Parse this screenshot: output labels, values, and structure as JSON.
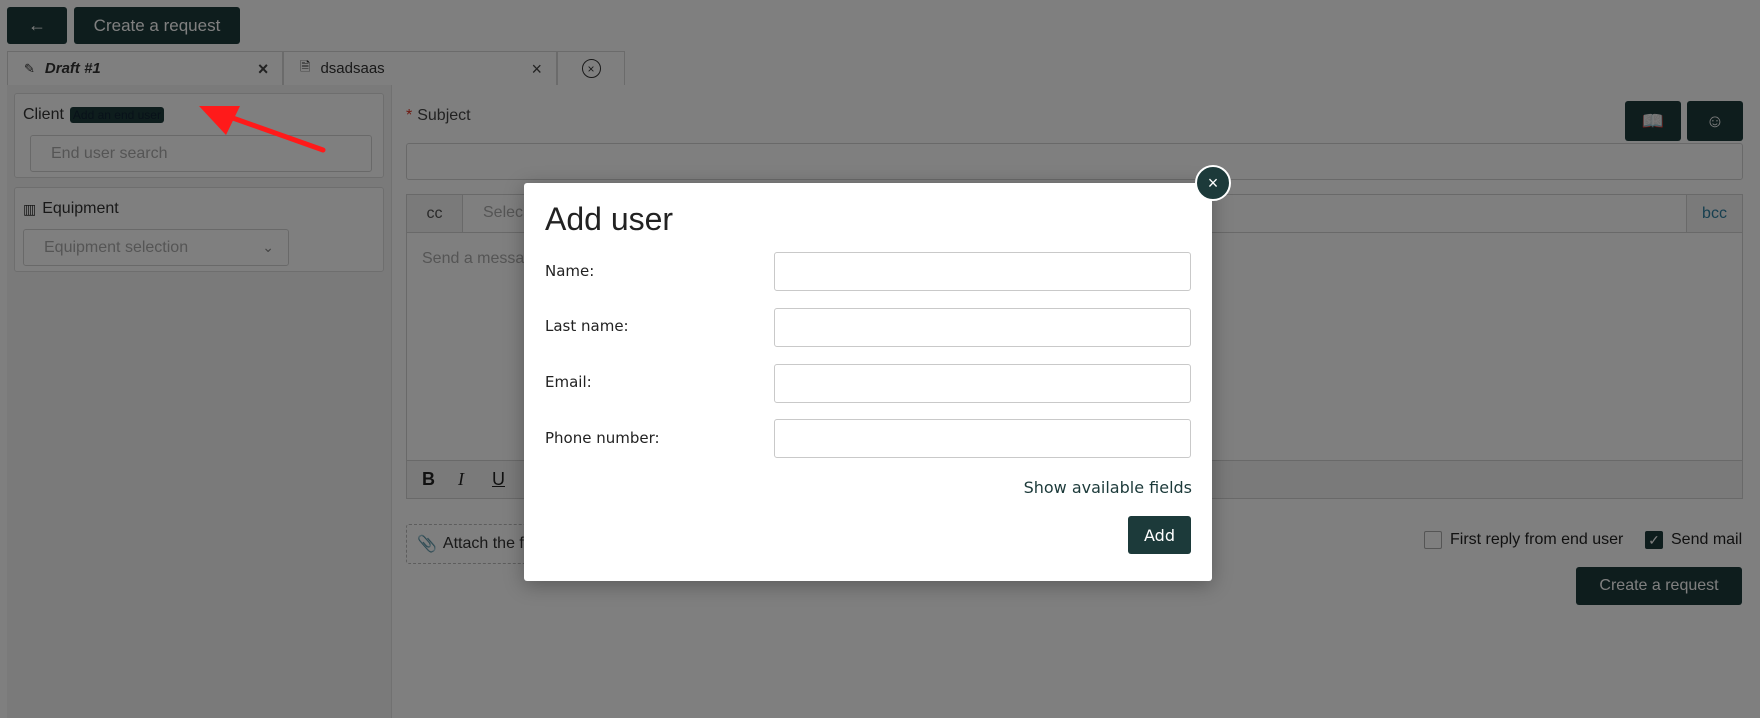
{
  "header": {
    "back_icon": "arrow-left-icon",
    "back_label": "←",
    "create_label": "Create a request"
  },
  "tabs": [
    {
      "label": "Draft #1",
      "icon": "edit-icon",
      "close": "×"
    },
    {
      "label": "dsadsaas",
      "icon": "document-icon",
      "close": "×"
    },
    {
      "icon": "close-circle-icon",
      "label": "×"
    }
  ],
  "client": {
    "label": "Client",
    "add_link": "Add an end user",
    "search_placeholder": "End user search"
  },
  "equipment": {
    "label": "Equipment",
    "icon": "equipment-icon",
    "select_placeholder": "Equipment selection"
  },
  "subject": {
    "required_mark": "*",
    "label": "Subject"
  },
  "right_buttons": {
    "book_icon": "book-icon",
    "emoji_icon": "smiley-icon"
  },
  "mail": {
    "cc_label": "cc",
    "cc_select_placeholder": "Selec",
    "bcc_label": "bcc",
    "message_placeholder": "Send a messa",
    "toolbar": {
      "bold": "B",
      "italic": "I",
      "underline": "U"
    }
  },
  "attach_label": "Attach the fi",
  "options": {
    "first_reply_label": "First reply from end user",
    "first_reply_checked": false,
    "send_mail_label": "Send mail",
    "send_mail_checked": true
  },
  "footer": {
    "create_label": "Create a request"
  },
  "modal": {
    "title": "Add user",
    "close_label": "×",
    "fields": [
      {
        "label": "Name:",
        "value": ""
      },
      {
        "label": "Last name:",
        "value": ""
      },
      {
        "label": "Email:",
        "value": ""
      },
      {
        "label": "Phone number:",
        "value": ""
      }
    ],
    "show_fields_label": "Show available fields",
    "add_label": "Add"
  },
  "colors": {
    "primary": "#1c3a3a",
    "annotation_arrow": "#ff1a1a",
    "required": "#dd3322",
    "bcc_link": "#2e7fa0"
  }
}
